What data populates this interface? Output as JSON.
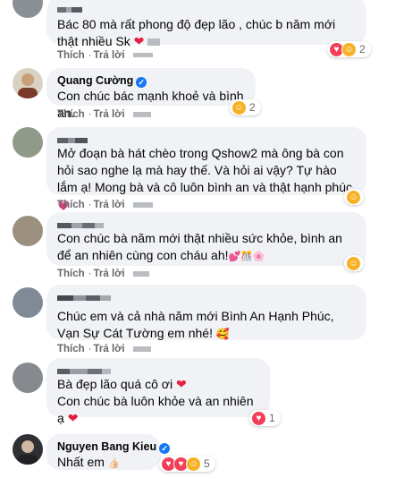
{
  "comments": [
    {
      "name": "",
      "text": "Bác 80 mà rất phong độ đẹp lão , chúc b năm mới thật nhiều Sk",
      "emoji": "❤",
      "reactions": [
        "love",
        "care"
      ],
      "count": "2",
      "like": "Thích",
      "reply": "Trả lời"
    },
    {
      "name": "Quang Cường",
      "verified": "✓",
      "text": "Con chúc bác mạnh khoẻ và bình an.",
      "reactions": [
        "care"
      ],
      "count": "2",
      "like": "Thích",
      "reply": "Trả lời"
    },
    {
      "name": "",
      "text": "Mở đoạn bà hát chèo trong Qshow2 mà ông bà con hỏi sao nghe lạ mà hay thế. Và hỏi ai vậy? Tự hào lắm ạ! Mong bà và cô luôn bình an và thật hạnh phúc",
      "emoji": "💗",
      "reactions": [
        "care"
      ],
      "count": "",
      "like": "Thích",
      "reply": "Trả lời"
    },
    {
      "name": "",
      "text": "Con chúc bà năm mới thật nhiều sức khỏe, bình an để an nhiên cùng con cháu ah!",
      "emoji": "💕🎊🌸",
      "reactions": [
        "care"
      ],
      "count": "",
      "like": "Thích",
      "reply": "Trả lời"
    },
    {
      "name": "",
      "text": "Chúc em và cả nhà năm mới Bình An Hạnh Phúc, Vạn Sự Cát Tường em nhé!",
      "emoji": "🥰",
      "reactions": [],
      "count": "",
      "like": "Thích",
      "reply": "Trả lời"
    },
    {
      "name": "",
      "text1": "Bà đẹp lão quá cô ơi",
      "emoji1": "❤",
      "text2": "Con chúc bà luôn khỏe và an nhiên ạ",
      "emoji2": "❤",
      "reactions": [
        "love"
      ],
      "count": "1",
      "like": "Thích",
      "reply": "Trả lời"
    },
    {
      "name": "Nguyen Bang Kieu",
      "verified": "✓",
      "text": "Nhất em",
      "emoji": "👍🏻",
      "reactions": [
        "love",
        "love",
        "care"
      ],
      "count": "5",
      "like": "Thích",
      "reply": "Trả lời"
    }
  ],
  "colors": {
    "bubble": "#f0f2f5",
    "secondary_text": "#65676b",
    "verified": "#1877f2",
    "love": "#f33e58",
    "care": "#f7b125"
  },
  "icons": {
    "verified": "verified-badge-icon",
    "love": "love-reaction-icon",
    "care": "care-reaction-icon"
  }
}
